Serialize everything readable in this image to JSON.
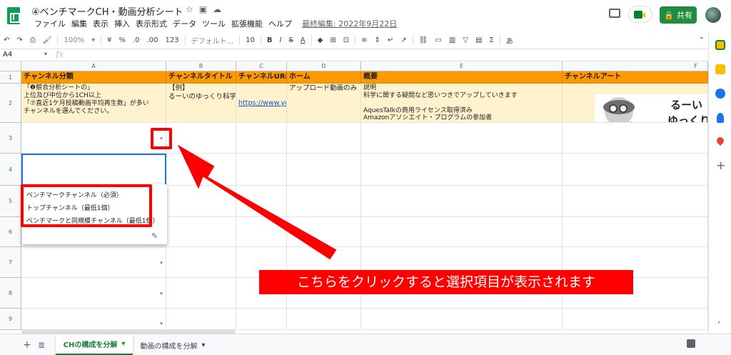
{
  "doc": {
    "title": "④ベンチマークCH・動画分析シート",
    "last_edit": "最終編集: 2022年9月22日",
    "share_label": "共有"
  },
  "menu": [
    "ファイル",
    "編集",
    "表示",
    "挿入",
    "表示形式",
    "データ",
    "ツール",
    "拡張機能",
    "ヘルプ"
  ],
  "toolbar": {
    "zoom": "100%",
    "currency": "¥",
    "percent": "%",
    "decimal_dec": ".0",
    "decimal_inc": ".00",
    "format_num": "123",
    "font": "デフォルト...",
    "font_size": "10",
    "bold": "B",
    "italic": "I",
    "strike": "S",
    "textcolor": "A",
    "input_tools": "あ"
  },
  "formula_bar": {
    "cell_ref": "A4",
    "fx": "fx",
    "value": ""
  },
  "columns": [
    "A",
    "B",
    "C",
    "D",
    "E",
    "F"
  ],
  "rows": [
    "1",
    "2",
    "3",
    "4",
    "5",
    "6",
    "7",
    "8",
    "9"
  ],
  "sheet": {
    "header": [
      "チャンネル分類",
      "チャンネルタイトル",
      "チャンネルURL",
      "ホーム",
      "概要",
      "チャンネルアート"
    ],
    "row2": {
      "a": "「❷競合分析シートの」\n上位及び中位から1CH以上\n「⑦直近1ケ月投稿動画平均再生数」が多い\nチャンネルを選んでください。",
      "b": "【例】\nるーいのゆっくり科学",
      "c": "https://www.you",
      "d": "アップロード動画のみ",
      "e": "説明\n科学に関する疑問など思いつきでアップしていきます\n\nAquesTalkの商用ライセンス取得済み\nAmazonアソシエイト・プログラムの参加者",
      "art_text": "るーい\nゆっくり"
    }
  },
  "dropdown_options": [
    "ベンチマークチャンネル（必須）",
    "トップチャンネル（最低1個）",
    "ベンチマークと同規模チャンネル（最低1個）"
  ],
  "callout": "こちらをクリックすると選択項目が表示されます",
  "tabs": {
    "active": "CHの構成を分解",
    "other": "動画の構成を分解"
  },
  "colors": {
    "header_bg": "#ff9900",
    "row2_bg": "#fff2cc",
    "annotation": "#ff0000",
    "share": "#1e8e3e",
    "active_tab": "#188038"
  }
}
